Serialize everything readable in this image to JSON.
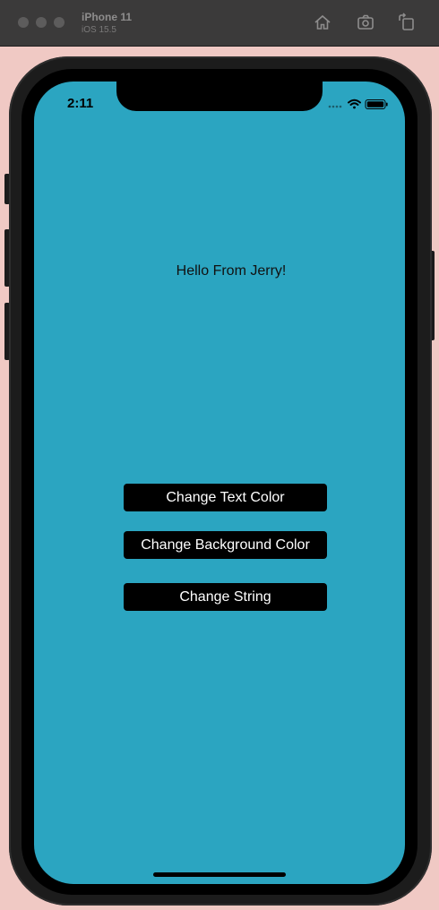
{
  "window": {
    "device_name": "iPhone 11",
    "os_version": "iOS 15.5",
    "toolbar_icons": [
      "home-icon",
      "screenshot-icon",
      "rotate-icon"
    ]
  },
  "status_bar": {
    "time": "2:11",
    "icons": [
      "signal-icon",
      "wifi-icon",
      "battery-icon"
    ]
  },
  "app": {
    "label_text": "Hello From Jerry!",
    "background_color": "#2ba5c1",
    "label_color": "#111111",
    "buttons": [
      {
        "label": "Change Text Color"
      },
      {
        "label": "Change Background Color"
      },
      {
        "label": "Change String"
      }
    ],
    "button_color": "#000000",
    "button_text_color": "#ffffff"
  }
}
